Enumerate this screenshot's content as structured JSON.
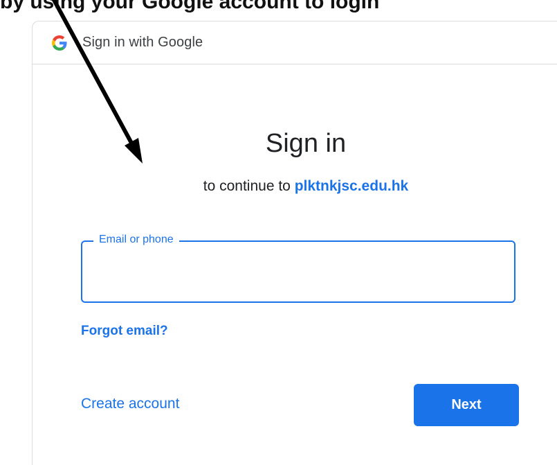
{
  "caption": "by using your Google account to login",
  "window": {
    "header_title": "Sign in with Google",
    "logo_icon": "google-g-logo"
  },
  "main": {
    "heading": "Sign in",
    "subheading_prefix": "to continue to ",
    "subheading_domain": "plktnkjsc.edu.hk"
  },
  "email_field": {
    "label": "Email or phone",
    "value": ""
  },
  "links": {
    "forgot_email": "Forgot email?",
    "create_account": "Create account"
  },
  "buttons": {
    "next": "Next"
  },
  "colors": {
    "accent": "#1a73e8",
    "annotation_arrow": "#000000"
  }
}
